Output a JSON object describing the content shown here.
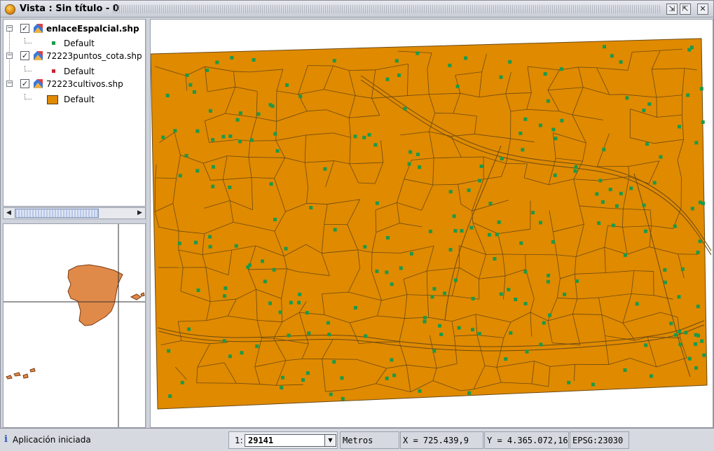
{
  "window": {
    "title": "Vista : Sin título - 0",
    "buttons": {
      "restore": "⇲",
      "maximize": "⇱",
      "close": "✕"
    }
  },
  "toc": {
    "layers": [
      {
        "name": "enlaceEspalcial.shp",
        "checked": true,
        "selected": true,
        "legend": {
          "label": "Default",
          "symbol": "point",
          "color": "#1a9a4a"
        }
      },
      {
        "name": "72223puntos_cota.shp",
        "checked": true,
        "selected": false,
        "legend": {
          "label": "Default",
          "symbol": "point",
          "color": "#cc2233"
        }
      },
      {
        "name": "72223cultivos.shp",
        "checked": true,
        "selected": false,
        "legend": {
          "label": "Default",
          "symbol": "polygon",
          "color": "#e08a00"
        }
      }
    ],
    "expander_glyph": "−",
    "check_glyph": "✓"
  },
  "scrollbar": {
    "left_arrow": "◀",
    "right_arrow": "▶"
  },
  "colors": {
    "parcel_fill": "#e08a00",
    "parcel_stroke": "#6b4a12",
    "point_fill": "#1a9a4a",
    "locator_land": "#e08a4a"
  },
  "status": {
    "info_icon": "i",
    "message": "Aplicación iniciada",
    "scale_prefix": "1:",
    "scale_value": "29141",
    "scale_drop": "▼",
    "units": "Metros",
    "x_coord": "X = 725.439,9",
    "y_coord": "Y = 4.365.072,16",
    "epsg": "EPSG:23030"
  }
}
